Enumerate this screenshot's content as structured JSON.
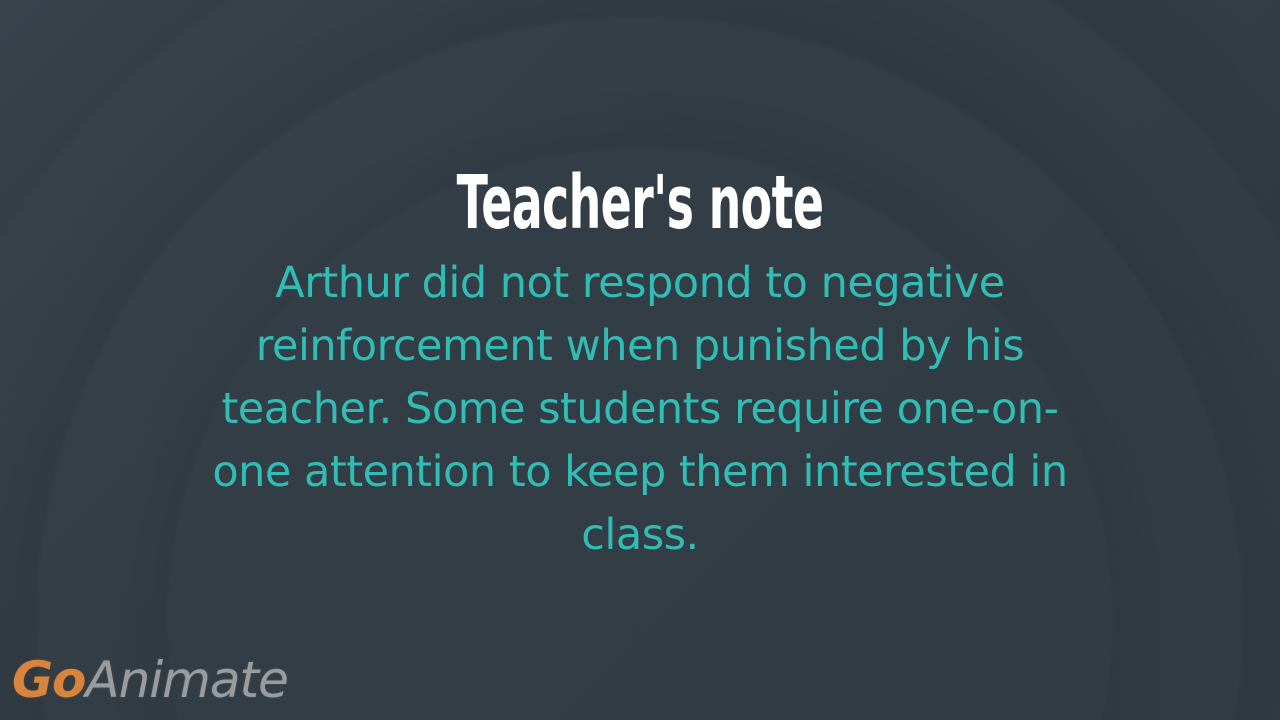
{
  "slide": {
    "title": "Teacher's note",
    "body": "Arthur did not respond to negative reinforcement when punished by his teacher. Some students require one-on-one attention to keep them interested in class."
  },
  "watermark": {
    "part1": "Go",
    "part2": "Animate"
  },
  "colors": {
    "background": "#333d45",
    "title": "#ffffff",
    "body": "#2fbdb6",
    "logo_go": "#d7843f",
    "logo_animate": "#9a9da0"
  }
}
